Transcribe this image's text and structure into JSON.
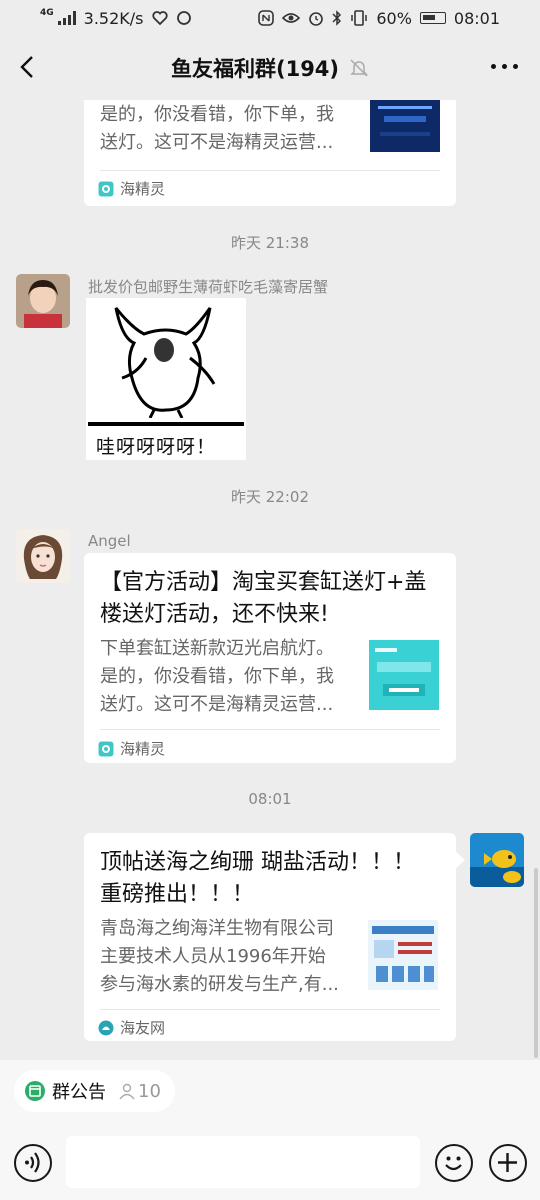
{
  "status_bar": {
    "network_type": "4G",
    "speed": "3.52K/s",
    "battery": "60%",
    "time": "08:01"
  },
  "nav": {
    "title": "鱼友福利群(194)",
    "icons": [
      "back-icon",
      "bell-off-icon",
      "more-icon"
    ]
  },
  "messages": [
    {
      "type": "link-card",
      "desc": "是的，你没看错，你下单，我送灯。这可不是海精灵运营...",
      "desc_lines": [
        "是的，你没看错，你下单，我",
        "送灯。这可不是海精灵运营..."
      ],
      "source": "海精灵"
    },
    {
      "type": "time",
      "text": "昨天 21:38"
    },
    {
      "type": "sticker",
      "sender": "批发价包邮野生薄荷虾吃毛藻寄居蟹",
      "sticker_caption": "哇呀呀呀呀！"
    },
    {
      "type": "time",
      "text": "昨天 22:02"
    },
    {
      "type": "link-card",
      "sender": "Angel",
      "title_lines": [
        "【官方活动】淘宝买套缸送灯+盖",
        "楼送灯活动，还不快来!"
      ],
      "desc_lines": [
        "下单套缸送新款迈光启航灯。",
        "是的，你没看错，你下单，我",
        "送灯。这可不是海精灵运营..."
      ],
      "source": "海精灵"
    },
    {
      "type": "time",
      "text": "08:01"
    },
    {
      "type": "link-card",
      "sender": "self",
      "title_lines": [
        "顶帖送海之绚珊 瑚盐活动！！！",
        "重磅推出！！！"
      ],
      "desc_lines": [
        "青岛海之绚海洋生物有限公司",
        "主要技术人员从1996年开始",
        "参与海水素的研发与生产,有..."
      ],
      "source": "海友网"
    }
  ],
  "notice": {
    "label": "群公告",
    "count": "10"
  },
  "input": {
    "placeholder": ""
  },
  "colors": {
    "background": "#ededed",
    "card": "#ffffff",
    "secondary_text": "#888888",
    "source_icon": "#2aae67"
  }
}
